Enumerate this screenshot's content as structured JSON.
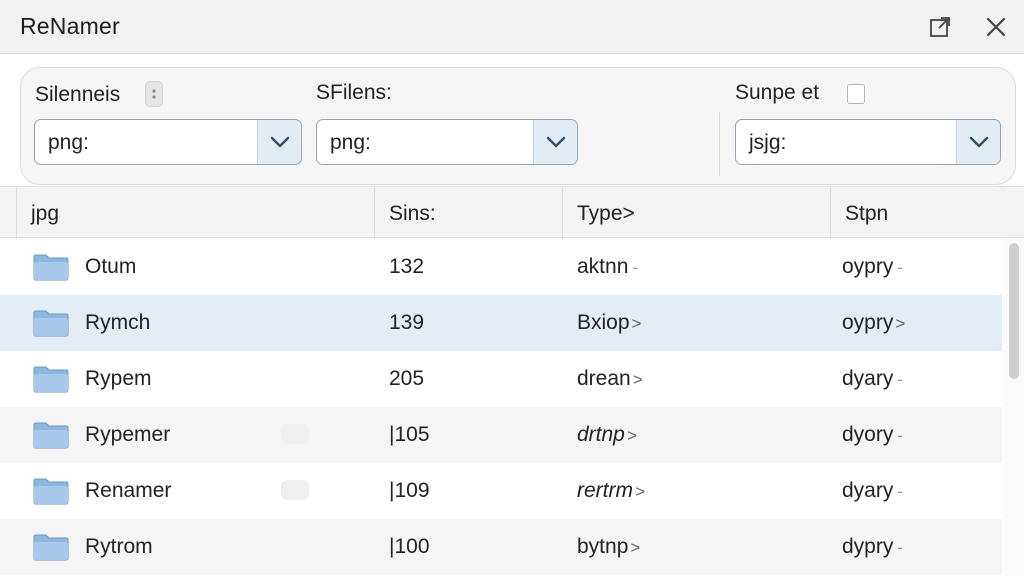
{
  "window": {
    "title": "ReNamer"
  },
  "filters": {
    "label_1": "Silenneis",
    "label_2": "SFilens:",
    "label_3": "Sunpe еt",
    "select_1": "png:",
    "select_2": "png:",
    "select_3": "jsjg:"
  },
  "table": {
    "headers": [
      "jpg",
      "Sins:",
      "Type>",
      "Stpn"
    ],
    "rows": [
      {
        "name": "Otum",
        "size": "132",
        "type": "aktnn",
        "type_marker": "-",
        "stpn": "oypry",
        "stpn_marker": "-"
      },
      {
        "name": "Rymch",
        "size": "139",
        "type": "Bxiop",
        "type_marker": ">",
        "stpn": "oypry",
        "stpn_marker": ">"
      },
      {
        "name": "Rypem",
        "size": "205",
        "type": "drean",
        "type_marker": ">",
        "stpn": "dyary",
        "stpn_marker": "-"
      },
      {
        "name": "Rypemer",
        "size": "|105",
        "type": "drtnp",
        "type_marker": ">",
        "stpn": "dyory",
        "stpn_marker": "-"
      },
      {
        "name": "Renamer",
        "size": "|109",
        "type": "rertrm",
        "type_marker": ">",
        "stpn": "dyary",
        "stpn_marker": "-"
      },
      {
        "name": "Rytrom",
        "size": "|100",
        "type": "bytnp",
        "type_marker": ">",
        "stpn": "dypry",
        "stpn_marker": "-"
      }
    ]
  },
  "icons": {
    "folder": "folder-icon",
    "maximize": "maximize-icon",
    "close": "close-icon",
    "dropdown": "chevron-down-icon"
  },
  "colors": {
    "selected_row": "#e4edf6",
    "folder_blue": "#8fb8e0",
    "dropdown_bg": "#e3ecf5"
  }
}
